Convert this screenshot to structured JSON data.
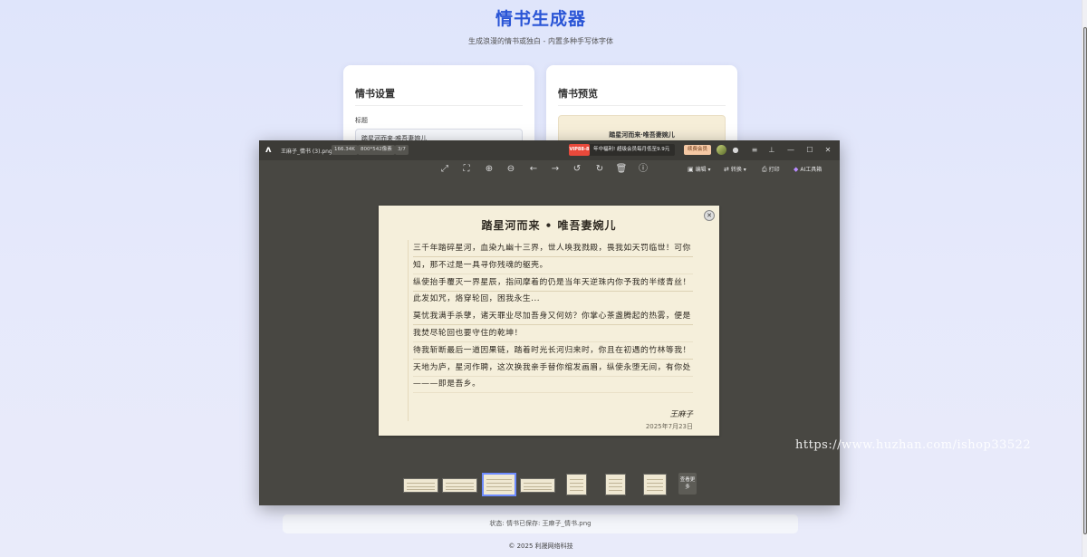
{
  "page": {
    "title": "情书生成器",
    "subtitle": "生成浪漫的情书或独白 - 内置多种手写体字体",
    "status": "状态: 情书已保存: 王麻子_情书.png",
    "footer": "© 2025 利晟网络科技"
  },
  "settings_card": {
    "title": "情书设置",
    "title_label": "标题",
    "title_value": "踏星河而来·唯吾妻婉儿"
  },
  "preview_card": {
    "title": "情书预览",
    "paper_title": "踏星河而来·唯吾妻婉儿"
  },
  "viewer": {
    "file_name": "王麻子_情书 (3).png",
    "file_size": "166.34K",
    "dimensions": "800*542像素",
    "index": "3/7",
    "promo_tag": "VIP88-8",
    "promo_text": "年中福利! 超级会员每月低至9.9元",
    "vip_label": "续费会员",
    "toolbar": {
      "edit_label": "编辑",
      "convert_label": "转换",
      "print_label": "打印",
      "ai_label": "AI工具箱"
    },
    "see_more": "查看更多",
    "watermark": "https://www.huzhan.com/ishop33522"
  },
  "letter": {
    "title": "踏星河而来 • 唯吾妻婉儿",
    "paragraphs": [
      "三千年踏碎星河，血染九幽十三界，世人唤我戮殿，畏我如天罚临世！可你知，那不过是一具寻你残魂的躯壳。",
      "纵使抬手覆灭一界星辰，指间摩着的仍是当年天逆珠内你予我的半缕青丝！此发如咒，烙穿轮回，困我永生...",
      "莫忧我满手杀孽，诸天罪业尽加吾身又何妨？你掌心茶盏腾起的热雾，便是我焚尽轮回也要守住的乾坤！",
      "待我斩断最后一道因果链，踏着时光长河归来时，你且在初遇的竹林等我！天地为庐，星河作聘，这次换我亲手替你绾发画眉，纵使永堕无间，有你处———即是吾乡。"
    ],
    "signature": "王麻子",
    "date": "2025年7月23日"
  }
}
